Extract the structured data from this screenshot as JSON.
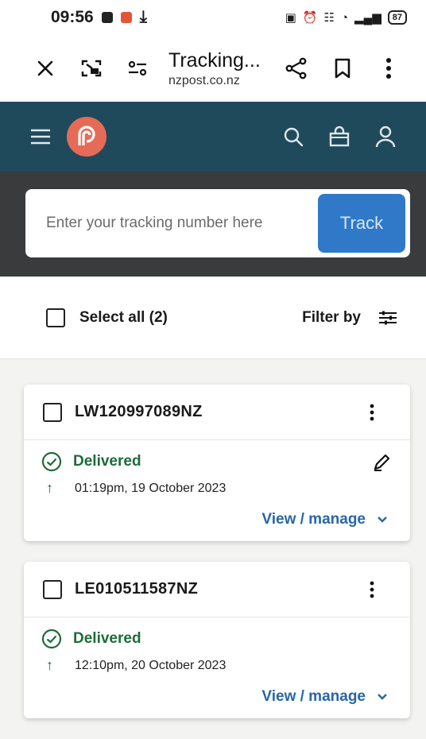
{
  "status_bar": {
    "time": "09:56",
    "battery": "87"
  },
  "toolbar": {
    "title": "Tracking...",
    "domain": "nzpost.co.nz"
  },
  "header": {
    "brand_color": "#1f4a5c",
    "logo_color": "#e56b57"
  },
  "search": {
    "placeholder": "Enter your tracking number here",
    "button_label": "Track"
  },
  "controls": {
    "select_all_label": "Select all (2)",
    "filter_label": "Filter by"
  },
  "parcels": [
    {
      "id": "LW120997089NZ",
      "status": "Delivered",
      "datetime": "01:19pm, 19 October 2023",
      "action": "View / manage"
    },
    {
      "id": "LE010511587NZ",
      "status": "Delivered",
      "datetime": "12:10pm, 20 October 2023",
      "action": "View / manage"
    }
  ],
  "colors": {
    "status_green": "#1d6b3a",
    "link_blue": "#2866a8",
    "track_blue": "#2f79c8"
  }
}
